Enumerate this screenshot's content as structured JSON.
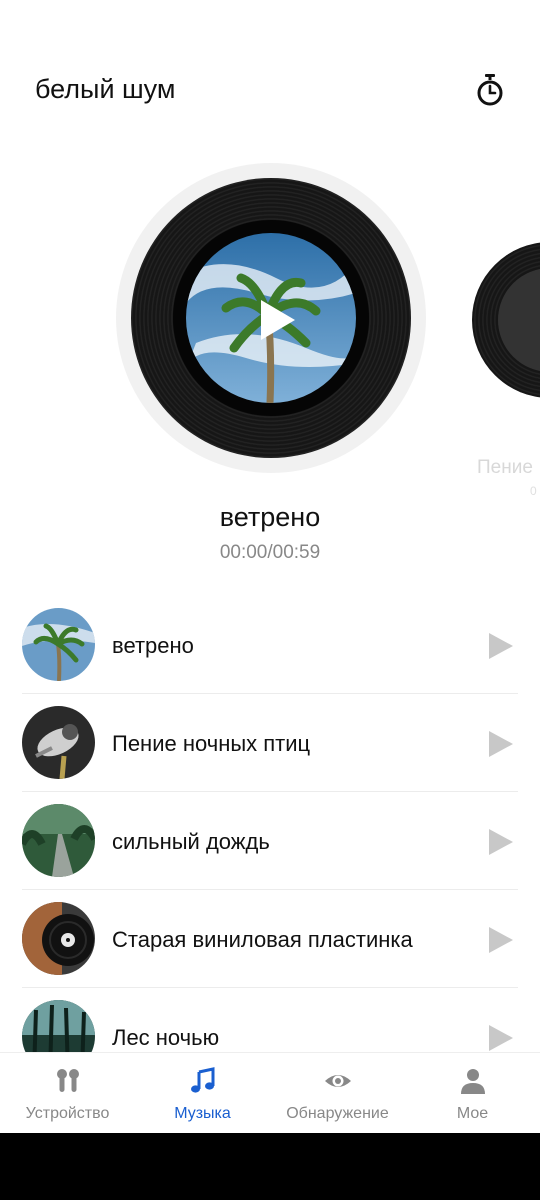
{
  "header": {
    "title": "белый шум",
    "timer_icon": "timer-icon"
  },
  "now_playing": {
    "title": "ветрено",
    "time": "00:00/00:59"
  },
  "carousel_next": {
    "label": "Пение",
    "sub": "0"
  },
  "tracks": [
    {
      "title": "ветрено",
      "thumb": "palm-sky"
    },
    {
      "title": "Пение ночных птиц",
      "thumb": "bird"
    },
    {
      "title": "сильный дождь",
      "thumb": "forest-road"
    },
    {
      "title": "Старая виниловая пластинка",
      "thumb": "vinyl"
    },
    {
      "title": "Лес ночью",
      "thumb": "night-forest"
    }
  ],
  "tabs": [
    {
      "label": "Устройство",
      "icon": "earbuds-icon",
      "active": false
    },
    {
      "label": "Музыка",
      "icon": "music-note-icon",
      "active": true
    },
    {
      "label": "Обнаружение",
      "icon": "eye-icon",
      "active": false
    },
    {
      "label": "Мое",
      "icon": "person-icon",
      "active": false
    }
  ],
  "colors": {
    "accent": "#1a5fd0",
    "inactive": "#888888",
    "play_gray": "#c8c8c8"
  }
}
